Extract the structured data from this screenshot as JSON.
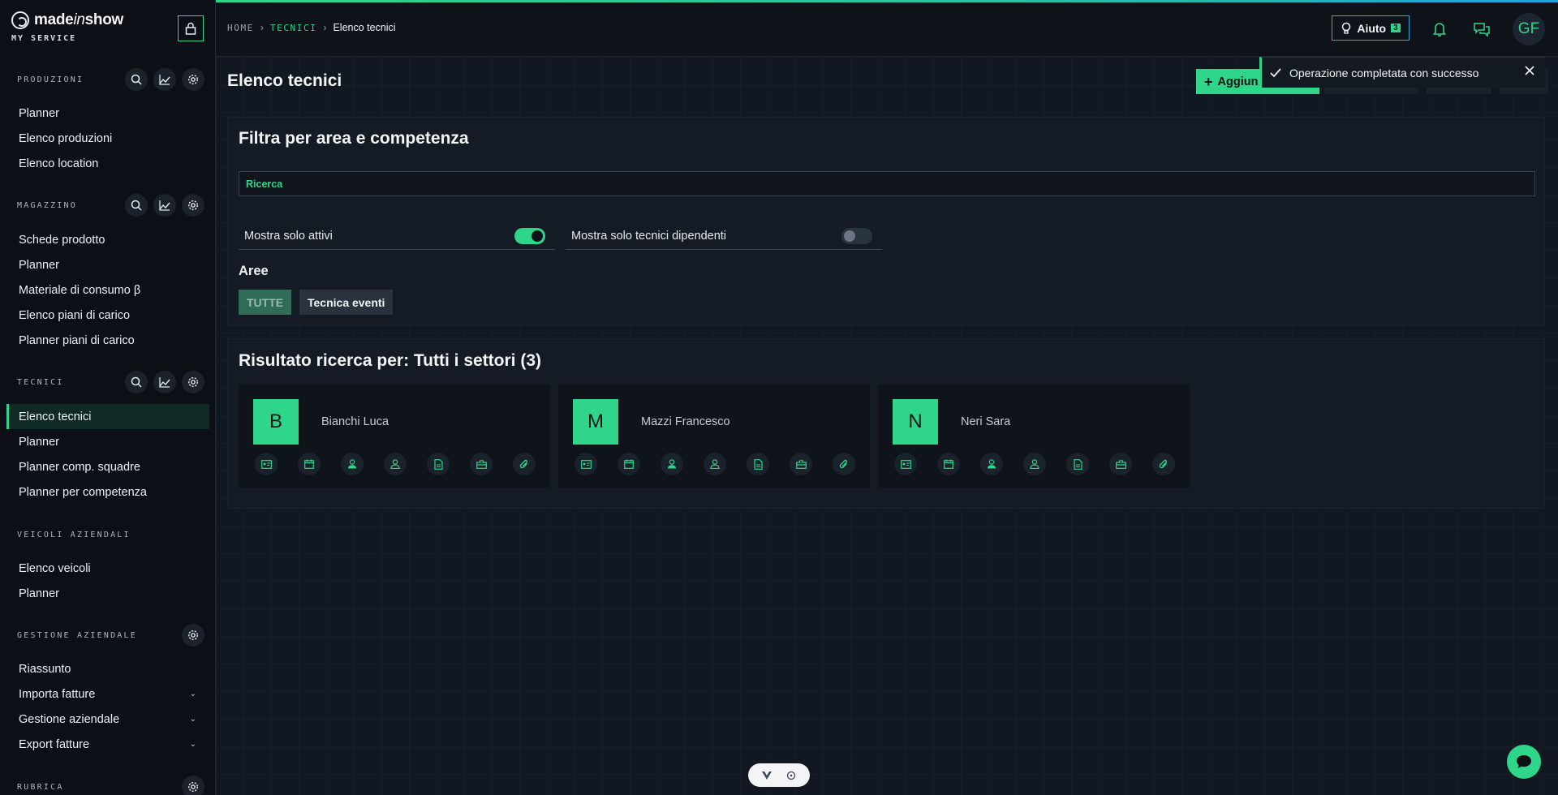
{
  "brand": {
    "name_prefix": "made",
    "name_italic": "in",
    "name_suffix": "show",
    "subtitle": "MY SERVICE"
  },
  "sidebar": {
    "sections": [
      {
        "title": "PRODUZIONI",
        "items": [
          "Planner",
          "Elenco produzioni",
          "Elenco location"
        ]
      },
      {
        "title": "MAGAZZINO",
        "items": [
          "Schede prodotto",
          "Planner",
          "Materiale di consumo β",
          "Elenco piani di carico",
          "Planner piani di carico"
        ]
      },
      {
        "title": "TECNICI",
        "items": [
          "Elenco tecnici",
          "Planner",
          "Planner comp. squadre",
          "Planner per competenza"
        ]
      },
      {
        "title": "VEICOLI AZIENDALI",
        "items": [
          "Elenco veicoli",
          "Planner"
        ]
      },
      {
        "title": "GESTIONE AZIENDALE",
        "items": [
          "Riassunto",
          "Importa fatture",
          "Gestione aziendale",
          "Export fatture"
        ]
      },
      {
        "title": "RUBRICA",
        "items": []
      }
    ],
    "active_item": "Elenco tecnici"
  },
  "breadcrumb": {
    "home": "HOME",
    "section": "TECNICI",
    "current": "Elenco tecnici"
  },
  "topbar": {
    "help_label": "Aiuto",
    "help_badge": "3",
    "user_initials": "GF"
  },
  "page": {
    "title": "Elenco tecnici",
    "add_button_label": "Aggiun"
  },
  "toast": {
    "message": "Operazione completata con successo"
  },
  "filter": {
    "title": "Filtra per area e competenza",
    "search_placeholder": "Ricerca",
    "toggle_active_label": "Mostra solo attivi",
    "toggle_active_value": true,
    "toggle_employees_label": "Mostra solo tecnici dipendenti",
    "toggle_employees_value": false,
    "areas_title": "Aree",
    "areas": [
      "TUTTE",
      "Tecnica eventi"
    ],
    "selected_area": "TUTTE"
  },
  "results": {
    "title": "Risultato ricerca per: Tutti i settori (3)",
    "technicians": [
      {
        "initial": "B",
        "name": "Bianchi Luca"
      },
      {
        "initial": "M",
        "name": "Mazzi Francesco"
      },
      {
        "initial": "N",
        "name": "Neri Sara"
      }
    ],
    "card_actions": [
      "id-card-icon",
      "calendar-icon",
      "user-icon",
      "user-alt-icon",
      "document-icon",
      "toolbox-icon",
      "paperclip-icon"
    ]
  },
  "colors": {
    "accent": "#2fd689",
    "background": "#121821",
    "sidebar": "#0c1016",
    "help_border": "#3aa0d8"
  }
}
